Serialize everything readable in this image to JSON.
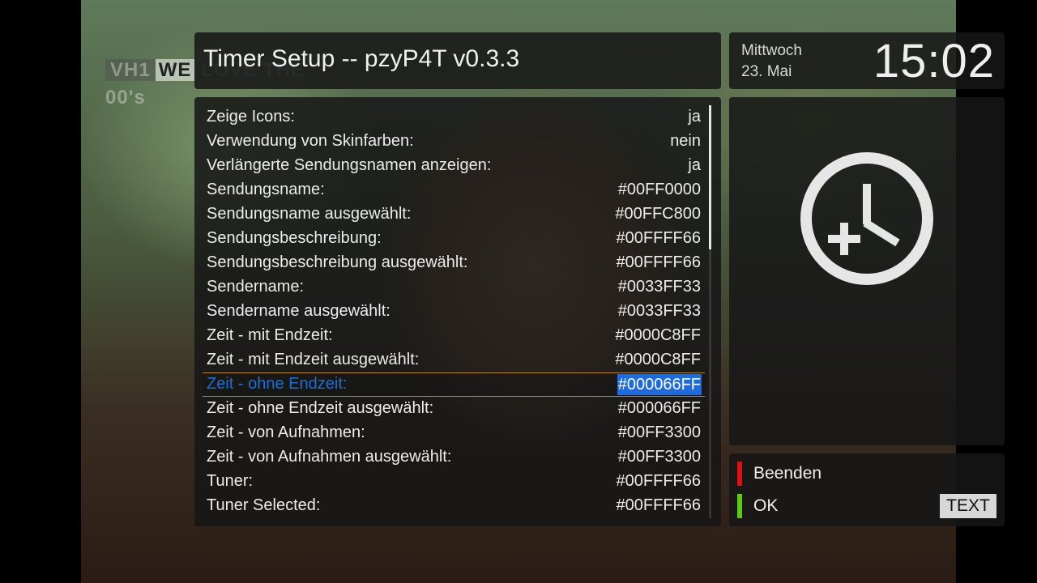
{
  "background": {
    "channel_logo": "VH1",
    "channel_logo_tag": "WE",
    "channel_logo_text": "LOVE THE 00's"
  },
  "title": "Timer Setup -- pzyP4T v0.3.3",
  "clock": {
    "day": "Mittwoch",
    "date": "23. Mai",
    "time": "15:02"
  },
  "settings": [
    {
      "label": "Zeige Icons:",
      "value": "ja"
    },
    {
      "label": "Verwendung von Skinfarben:",
      "value": "nein"
    },
    {
      "label": "Verlängerte Sendungsnamen anzeigen:",
      "value": "ja"
    },
    {
      "label": "Sendungsname:",
      "value": "#00FF0000"
    },
    {
      "label": "Sendungsname ausgewählt:",
      "value": "#00FFC800"
    },
    {
      "label": "Sendungsbeschreibung:",
      "value": "#00FFFF66"
    },
    {
      "label": "Sendungsbeschreibung ausgewählt:",
      "value": "#00FFFF66"
    },
    {
      "label": "Sendername:",
      "value": "#0033FF33"
    },
    {
      "label": "Sendername ausgewählt:",
      "value": "#0033FF33"
    },
    {
      "label": "Zeit - mit Endzeit:",
      "value": "#0000C8FF"
    },
    {
      "label": "Zeit - mit Endzeit ausgewählt:",
      "value": "#0000C8FF"
    },
    {
      "label": "Zeit - ohne Endzeit:",
      "value": "#000066FF"
    },
    {
      "label": "Zeit - ohne Endzeit ausgewählt:",
      "value": "#000066FF"
    },
    {
      "label": "Zeit - von Aufnahmen:",
      "value": "#00FF3300"
    },
    {
      "label": "Zeit - von Aufnahmen ausgewählt:",
      "value": "#00FF3300"
    },
    {
      "label": "Tuner:",
      "value": "#00FFFF66"
    },
    {
      "label": "Tuner Selected:",
      "value": "#00FFFF66"
    }
  ],
  "selected_index": 11,
  "icon": "add-timer-clock-icon",
  "keys": {
    "red_label": "Beenden",
    "green_label": "OK",
    "text_label": "TEXT"
  },
  "colors": {
    "selection_label": "#1c6fd8",
    "selection_value_bg": "#1e6ae0",
    "selection_border": "#b9872a",
    "red_key": "#e01010",
    "green_key": "#5ccc10"
  }
}
